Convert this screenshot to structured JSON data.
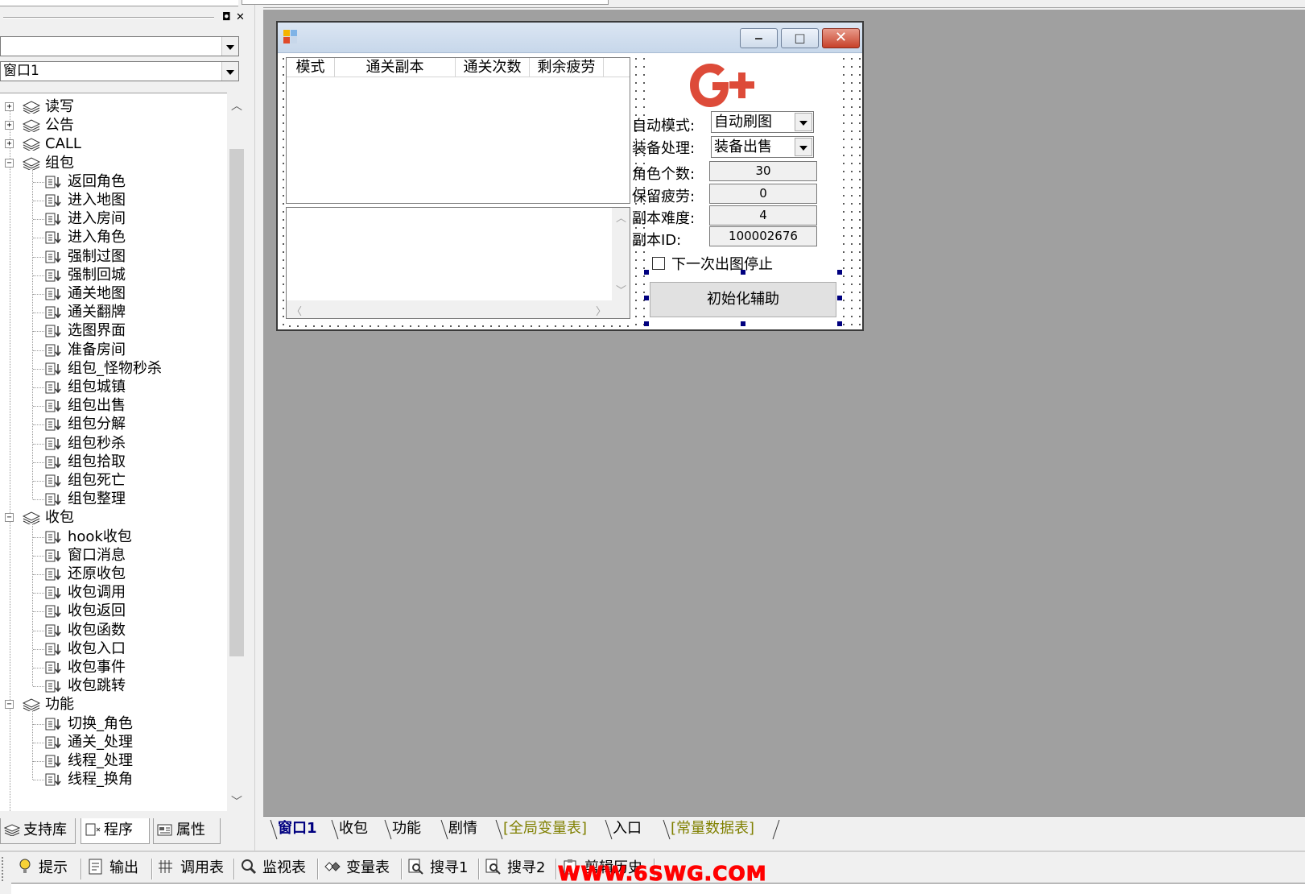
{
  "left_panel": {
    "object_combo_value": "",
    "window_combo_value": "窗口1",
    "tree": {
      "groups": [
        {
          "label": "读写",
          "expanded": false,
          "items": []
        },
        {
          "label": "公告",
          "expanded": false,
          "items": []
        },
        {
          "label": "CALL",
          "expanded": false,
          "items": []
        },
        {
          "label": "组包",
          "expanded": true,
          "items": [
            "返回角色",
            "进入地图",
            "进入房间",
            "进入角色",
            "强制过图",
            "强制回城",
            "通关地图",
            "通关翻牌",
            "选图界面",
            "准备房间",
            "组包_怪物秒杀",
            "组包城镇",
            "组包出售",
            "组包分解",
            "组包秒杀",
            "组包拾取",
            "组包死亡",
            "组包整理"
          ]
        },
        {
          "label": "收包",
          "expanded": true,
          "items": [
            "hook收包",
            "窗口消息",
            "还原收包",
            "收包调用",
            "收包返回",
            "收包函数",
            "收包入口",
            "收包事件",
            "收包跳转"
          ]
        },
        {
          "label": "功能",
          "expanded": true,
          "items": [
            "切换_角色",
            "通关_处理",
            "线程_处理",
            "线程_换角"
          ]
        }
      ]
    },
    "tabs": [
      "支持库",
      "程序",
      "属性"
    ]
  },
  "form": {
    "listview_columns": [
      "模式",
      "通关副本",
      "通关次数",
      "剩余疲劳"
    ],
    "fields": {
      "auto_mode_label": "自动模式:",
      "auto_mode_value": "自动刷图",
      "equip_label": "装备处理:",
      "equip_value": "装备出售",
      "role_count_label": "角色个数:",
      "role_count_value": "30",
      "keep_fatigue_label": "保留疲劳:",
      "keep_fatigue_value": "0",
      "difficulty_label": "副本难度:",
      "difficulty_value": "4",
      "dungeon_id_label": "副本ID:",
      "dungeon_id_value": "100002676"
    },
    "checkbox_label": "下一次出图停止",
    "init_button": "初始化辅助",
    "logo_text": "G+"
  },
  "design_tabs": [
    "窗口1",
    "收包",
    "功能",
    "剧情",
    "[全局变量表]",
    "入口",
    "[常量数据表]"
  ],
  "output_toolbar": [
    "提示",
    "输出",
    "调用表",
    "监视表",
    "变量表",
    "搜寻1",
    "搜寻2",
    "剪辑历史"
  ],
  "watermark": "WWW.6SWG.COM",
  "colors": {
    "design_bg": "#a0a0a0",
    "logo_red": "#dd4b39",
    "olive_tab": "#808000",
    "watermark_red": "#ff0000"
  }
}
